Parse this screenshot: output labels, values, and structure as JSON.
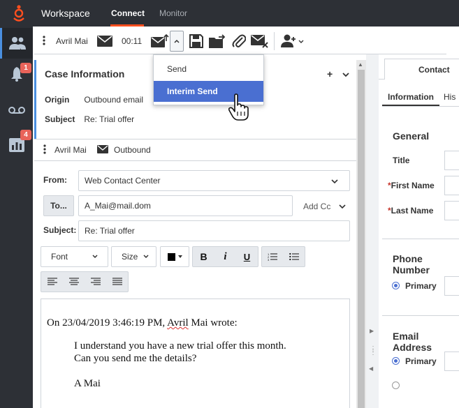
{
  "app": {
    "title": "Workspace",
    "tabs": [
      "Connect",
      "Monitor"
    ],
    "active_tab": "Connect",
    "accent": "#ff4f1f"
  },
  "rail": {
    "items": [
      {
        "icon": "contacts-icon",
        "badge": ""
      },
      {
        "icon": "bell-icon",
        "badge": "1"
      },
      {
        "icon": "voicemail-icon",
        "badge": ""
      },
      {
        "icon": "reports-icon",
        "badge": "4"
      }
    ]
  },
  "interaction": {
    "contact_name": "Avril Mai",
    "timer": "00:11"
  },
  "case": {
    "title": "Case Information",
    "origin_label": "Origin",
    "origin_value": "Outbound email",
    "subject_label": "Subject",
    "subject_value": "Re: Trial offer"
  },
  "subinteraction": {
    "name": "Avril Mai",
    "direction": "Outbound"
  },
  "email": {
    "from_label": "From:",
    "from_value": "Web Contact Center",
    "to_button": "To...",
    "to_value": "A_Mai@mail.dom",
    "add_cc": "Add Cc",
    "subject_label": "Subject:",
    "subject_value": "Re: Trial offer",
    "font_label": "Font",
    "size_label": "Size",
    "bold": "B",
    "italic": "i",
    "underline": "U",
    "quote_header_prefix": "On 23/04/2019 3:46:19 PM, ",
    "quote_header_name": "Avril",
    "quote_header_suffix": " Mai wrote:",
    "quote_line1": "I understand you have a new trial offer this month.",
    "quote_line2": "Can you send me the details?",
    "quote_sign": "A Mai"
  },
  "send_menu": {
    "items": [
      "Send",
      "Interim Send"
    ],
    "highlighted": "Interim Send",
    "highlight_color": "#4a6fd1"
  },
  "right_panel": {
    "tab": "Contact",
    "subtabs": [
      "Information",
      "His"
    ],
    "general": "General",
    "title_label": "Title",
    "first_name_label": "First Name",
    "last_name_label": "Last Name",
    "phone_section": "Phone Number",
    "email_section": "Email Address",
    "primary_label": "Primary",
    "required_mark": "*"
  }
}
